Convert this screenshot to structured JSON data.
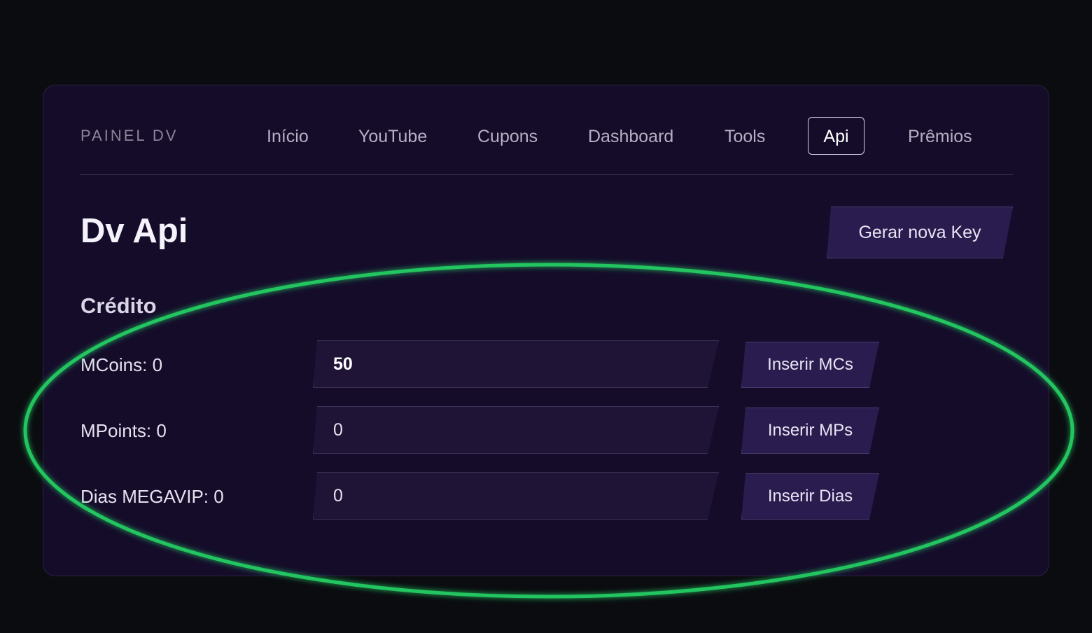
{
  "nav": {
    "brand": "PAINEL DV",
    "items": [
      {
        "label": "Início",
        "active": false
      },
      {
        "label": "YouTube",
        "active": false
      },
      {
        "label": "Cupons",
        "active": false
      },
      {
        "label": "Dashboard",
        "active": false
      },
      {
        "label": "Tools",
        "active": false
      },
      {
        "label": "Api",
        "active": true
      },
      {
        "label": "Prêmios",
        "active": false
      }
    ]
  },
  "page": {
    "title": "Dv Api",
    "generate_key_label": "Gerar nova Key"
  },
  "credit": {
    "title": "Crédito",
    "rows": [
      {
        "label": "MCoins: 0",
        "value": "50",
        "button": "Inserir MCs"
      },
      {
        "label": "MPoints: 0",
        "value": "0",
        "button": "Inserir MPs"
      },
      {
        "label": "Dias MEGAVIP: 0",
        "value": "0",
        "button": "Inserir Dias"
      }
    ]
  },
  "colors": {
    "background": "#0b0c10",
    "card": "#150c2a",
    "button": "#2b1c4f",
    "highlight_ellipse": "#22c55e"
  }
}
